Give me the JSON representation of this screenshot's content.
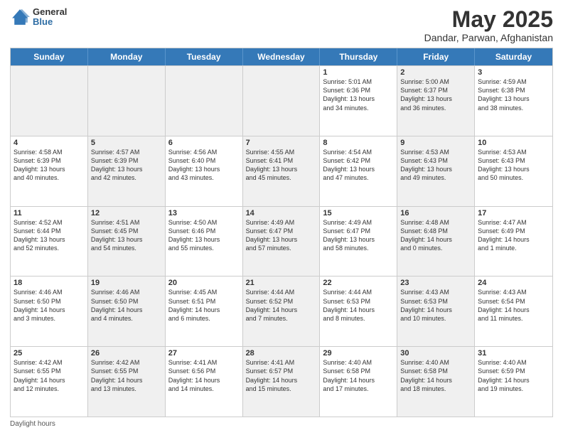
{
  "header": {
    "logo_general": "General",
    "logo_blue": "Blue",
    "title": "May 2025",
    "location": "Dandar, Parwan, Afghanistan"
  },
  "days_of_week": [
    "Sunday",
    "Monday",
    "Tuesday",
    "Wednesday",
    "Thursday",
    "Friday",
    "Saturday"
  ],
  "weeks": [
    [
      {
        "day": "",
        "content": "",
        "shaded": true
      },
      {
        "day": "",
        "content": "",
        "shaded": true
      },
      {
        "day": "",
        "content": "",
        "shaded": true
      },
      {
        "day": "",
        "content": "",
        "shaded": true
      },
      {
        "day": "1",
        "content": "Sunrise: 5:01 AM\nSunset: 6:36 PM\nDaylight: 13 hours\nand 34 minutes.",
        "shaded": false
      },
      {
        "day": "2",
        "content": "Sunrise: 5:00 AM\nSunset: 6:37 PM\nDaylight: 13 hours\nand 36 minutes.",
        "shaded": true
      },
      {
        "day": "3",
        "content": "Sunrise: 4:59 AM\nSunset: 6:38 PM\nDaylight: 13 hours\nand 38 minutes.",
        "shaded": false
      }
    ],
    [
      {
        "day": "4",
        "content": "Sunrise: 4:58 AM\nSunset: 6:39 PM\nDaylight: 13 hours\nand 40 minutes.",
        "shaded": false
      },
      {
        "day": "5",
        "content": "Sunrise: 4:57 AM\nSunset: 6:39 PM\nDaylight: 13 hours\nand 42 minutes.",
        "shaded": true
      },
      {
        "day": "6",
        "content": "Sunrise: 4:56 AM\nSunset: 6:40 PM\nDaylight: 13 hours\nand 43 minutes.",
        "shaded": false
      },
      {
        "day": "7",
        "content": "Sunrise: 4:55 AM\nSunset: 6:41 PM\nDaylight: 13 hours\nand 45 minutes.",
        "shaded": true
      },
      {
        "day": "8",
        "content": "Sunrise: 4:54 AM\nSunset: 6:42 PM\nDaylight: 13 hours\nand 47 minutes.",
        "shaded": false
      },
      {
        "day": "9",
        "content": "Sunrise: 4:53 AM\nSunset: 6:43 PM\nDaylight: 13 hours\nand 49 minutes.",
        "shaded": true
      },
      {
        "day": "10",
        "content": "Sunrise: 4:53 AM\nSunset: 6:43 PM\nDaylight: 13 hours\nand 50 minutes.",
        "shaded": false
      }
    ],
    [
      {
        "day": "11",
        "content": "Sunrise: 4:52 AM\nSunset: 6:44 PM\nDaylight: 13 hours\nand 52 minutes.",
        "shaded": false
      },
      {
        "day": "12",
        "content": "Sunrise: 4:51 AM\nSunset: 6:45 PM\nDaylight: 13 hours\nand 54 minutes.",
        "shaded": true
      },
      {
        "day": "13",
        "content": "Sunrise: 4:50 AM\nSunset: 6:46 PM\nDaylight: 13 hours\nand 55 minutes.",
        "shaded": false
      },
      {
        "day": "14",
        "content": "Sunrise: 4:49 AM\nSunset: 6:47 PM\nDaylight: 13 hours\nand 57 minutes.",
        "shaded": true
      },
      {
        "day": "15",
        "content": "Sunrise: 4:49 AM\nSunset: 6:47 PM\nDaylight: 13 hours\nand 58 minutes.",
        "shaded": false
      },
      {
        "day": "16",
        "content": "Sunrise: 4:48 AM\nSunset: 6:48 PM\nDaylight: 14 hours\nand 0 minutes.",
        "shaded": true
      },
      {
        "day": "17",
        "content": "Sunrise: 4:47 AM\nSunset: 6:49 PM\nDaylight: 14 hours\nand 1 minute.",
        "shaded": false
      }
    ],
    [
      {
        "day": "18",
        "content": "Sunrise: 4:46 AM\nSunset: 6:50 PM\nDaylight: 14 hours\nand 3 minutes.",
        "shaded": false
      },
      {
        "day": "19",
        "content": "Sunrise: 4:46 AM\nSunset: 6:50 PM\nDaylight: 14 hours\nand 4 minutes.",
        "shaded": true
      },
      {
        "day": "20",
        "content": "Sunrise: 4:45 AM\nSunset: 6:51 PM\nDaylight: 14 hours\nand 6 minutes.",
        "shaded": false
      },
      {
        "day": "21",
        "content": "Sunrise: 4:44 AM\nSunset: 6:52 PM\nDaylight: 14 hours\nand 7 minutes.",
        "shaded": true
      },
      {
        "day": "22",
        "content": "Sunrise: 4:44 AM\nSunset: 6:53 PM\nDaylight: 14 hours\nand 8 minutes.",
        "shaded": false
      },
      {
        "day": "23",
        "content": "Sunrise: 4:43 AM\nSunset: 6:53 PM\nDaylight: 14 hours\nand 10 minutes.",
        "shaded": true
      },
      {
        "day": "24",
        "content": "Sunrise: 4:43 AM\nSunset: 6:54 PM\nDaylight: 14 hours\nand 11 minutes.",
        "shaded": false
      }
    ],
    [
      {
        "day": "25",
        "content": "Sunrise: 4:42 AM\nSunset: 6:55 PM\nDaylight: 14 hours\nand 12 minutes.",
        "shaded": false
      },
      {
        "day": "26",
        "content": "Sunrise: 4:42 AM\nSunset: 6:55 PM\nDaylight: 14 hours\nand 13 minutes.",
        "shaded": true
      },
      {
        "day": "27",
        "content": "Sunrise: 4:41 AM\nSunset: 6:56 PM\nDaylight: 14 hours\nand 14 minutes.",
        "shaded": false
      },
      {
        "day": "28",
        "content": "Sunrise: 4:41 AM\nSunset: 6:57 PM\nDaylight: 14 hours\nand 15 minutes.",
        "shaded": true
      },
      {
        "day": "29",
        "content": "Sunrise: 4:40 AM\nSunset: 6:58 PM\nDaylight: 14 hours\nand 17 minutes.",
        "shaded": false
      },
      {
        "day": "30",
        "content": "Sunrise: 4:40 AM\nSunset: 6:58 PM\nDaylight: 14 hours\nand 18 minutes.",
        "shaded": true
      },
      {
        "day": "31",
        "content": "Sunrise: 4:40 AM\nSunset: 6:59 PM\nDaylight: 14 hours\nand 19 minutes.",
        "shaded": false
      }
    ]
  ],
  "footer": {
    "note": "Daylight hours"
  }
}
